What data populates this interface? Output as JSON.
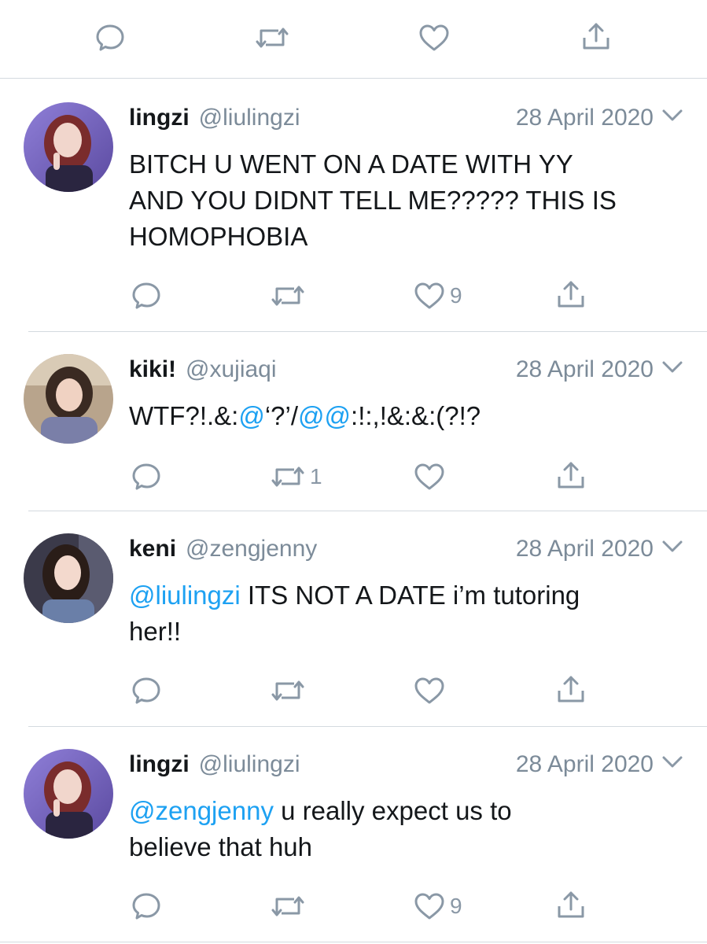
{
  "top_actions": {
    "reply_count": "",
    "retweet_count": "",
    "like_count": ""
  },
  "tweets": [
    {
      "name": "lingzi",
      "handle": "@liulingzi",
      "date": "28 April 2020",
      "text_1": "BITCH U WENT ON A DATE WITH YY",
      "text_2": "AND YOU DIDNT TELL ME????? THIS IS",
      "text_3": "HOMOPHOBIA",
      "reply_count": "",
      "retweet_count": "",
      "like_count": "9"
    },
    {
      "name": "kiki!",
      "handle": "@xujiaqi",
      "date": "28 April 2020",
      "text_a": "WTF?!.&:",
      "text_m1": "@",
      "text_b": "‘?’/",
      "text_m2": "@@",
      "text_c": ":!:,!&:&:(?!?",
      "reply_count": "",
      "retweet_count": "1",
      "like_count": ""
    },
    {
      "name": "keni",
      "handle": "@zengjenny",
      "date": "28 April 2020",
      "mention": "@liulingzi",
      "text_1": " ITS NOT A DATE i’m tutoring",
      "text_2": "her!!",
      "reply_count": "",
      "retweet_count": "",
      "like_count": ""
    },
    {
      "name": "lingzi",
      "handle": "@liulingzi",
      "date": "28 April 2020",
      "mention": "@zengjenny",
      "text_1": " u really expect us to",
      "text_2": "believe that huh",
      "reply_count": "",
      "retweet_count": "",
      "like_count": "9"
    }
  ],
  "colors": {
    "text": "#14171a",
    "secondary": "#7c8b99",
    "icon": "#8a98a6",
    "link": "#1da1f2",
    "divider": "#d4dadf"
  },
  "icons": [
    "reply-icon",
    "retweet-icon",
    "like-icon",
    "share-icon",
    "chevron-down-icon"
  ]
}
